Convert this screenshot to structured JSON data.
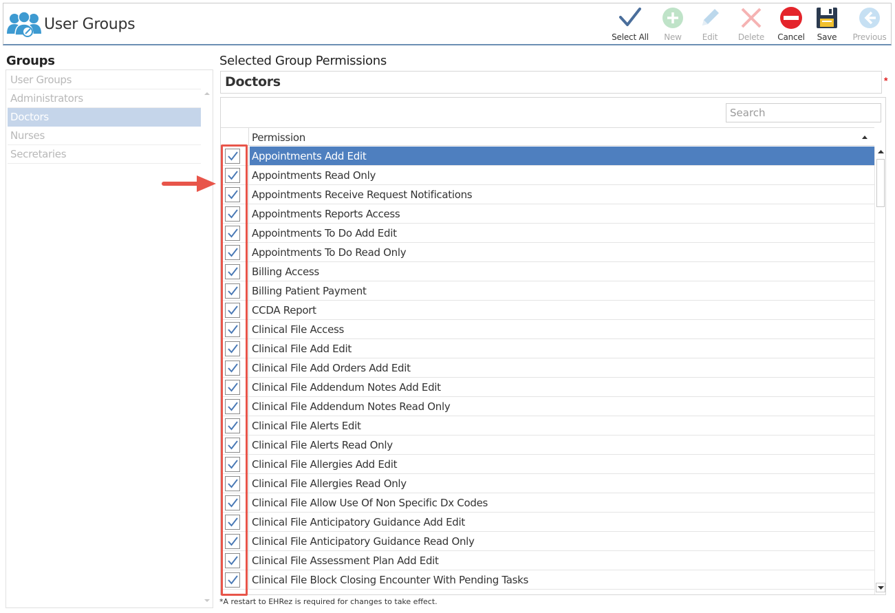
{
  "app": {
    "title": "User Groups",
    "icon": "users-group-icon"
  },
  "toolbar": {
    "items": [
      {
        "label": "Select All",
        "icon": "checkmark-icon",
        "enabled": true
      },
      {
        "label": "New",
        "icon": "plus-circle-icon",
        "enabled": false
      },
      {
        "label": "Edit",
        "icon": "pencil-icon",
        "enabled": false
      },
      {
        "label": "Delete",
        "icon": "x-icon",
        "enabled": false
      },
      {
        "label": "Cancel",
        "icon": "no-entry-icon",
        "enabled": true
      },
      {
        "label": "Save",
        "icon": "floppy-disk-icon",
        "enabled": true
      },
      {
        "label": "Previous",
        "icon": "arrow-left-circle-icon",
        "enabled": false
      }
    ]
  },
  "groups": {
    "title": "Groups",
    "items": [
      "User Groups",
      "Administrators",
      "Doctors",
      "Nurses",
      "Secretaries"
    ],
    "selected": "Doctors"
  },
  "permissions": {
    "title": "Selected Group Permissions",
    "group_name": "Doctors",
    "required_mark": "*",
    "search_placeholder": "Search",
    "column_header": "Permission",
    "rows": [
      "Appointments Add Edit",
      "Appointments Read Only",
      "Appointments Receive Request Notifications",
      "Appointments Reports Access",
      "Appointments To Do Add Edit",
      "Appointments To Do Read Only",
      "Billing Access",
      "Billing Patient Payment",
      "CCDA Report",
      "Clinical File Access",
      "Clinical File Add Edit",
      "Clinical File Add Orders Add Edit",
      "Clinical File Addendum Notes Add Edit",
      "Clinical File Addendum Notes Read Only",
      "Clinical File Alerts Edit",
      "Clinical File Alerts Read Only",
      "Clinical File Allergies Add Edit",
      "Clinical File Allergies Read Only",
      "Clinical File Allow Use Of Non Specific Dx Codes",
      "Clinical File Anticipatory Guidance Add Edit",
      "Clinical File Anticipatory Guidance Read Only",
      "Clinical File Assessment Plan Add Edit",
      "Clinical File Block Closing Encounter With Pending Tasks"
    ],
    "selected_row": "Appointments Add Edit",
    "all_checked": true,
    "footnote": "*A restart to EHRez is required for changes to take effect."
  },
  "colors": {
    "selected_row": "#4e7fbf",
    "selected_group": "#c5d5ea",
    "checkmark": "#4a79b5",
    "annotation": "#e8554a",
    "header_border": "#6b8fb3"
  }
}
